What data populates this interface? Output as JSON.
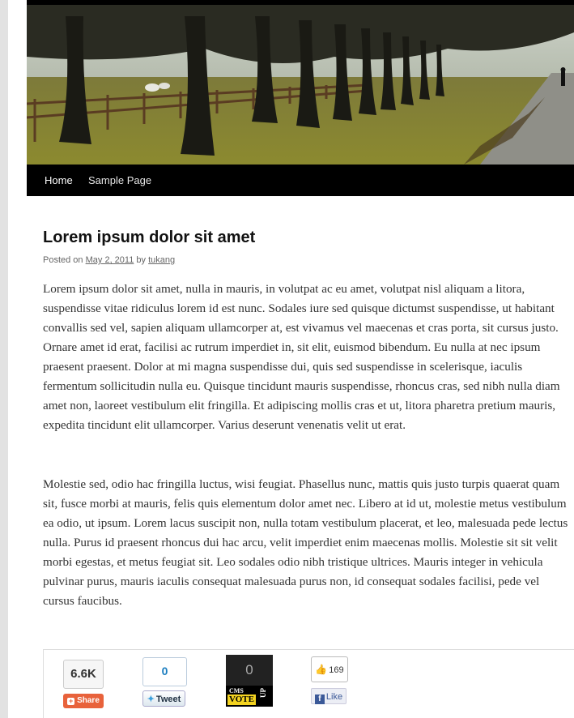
{
  "nav": {
    "items": [
      {
        "label": "Home"
      },
      {
        "label": "Sample Page"
      }
    ]
  },
  "post": {
    "title": "Lorem ipsum dolor sit amet",
    "meta": {
      "posted_on": "Posted on",
      "date": "May 2, 2011",
      "by": "by",
      "author": "tukang"
    },
    "paragraphs": [
      "Lorem ipsum dolor sit amet, nulla in mauris, in volutpat ac eu amet, volutpat nisl aliquam a litora, suspendisse vitae ridiculus lorem id est nunc. Sodales iure sed quisque dictumst suspendisse, ut habitant convallis sed vel, sapien aliquam ullamcorper at, est vivamus vel maecenas et cras porta, sit cursus justo. Ornare amet id erat, facilisi ac rutrum imperdiet in, sit elit, euismod bibendum. Eu nulla at nec ipsum praesent praesent. Dolor at mi magna suspendisse dui, quis sed suspendisse in scelerisque, iaculis fermentum sollicitudin nulla eu. Quisque tincidunt mauris suspendisse, rhoncus cras, sed nibh nulla diam amet non, laoreet vestibulum elit fringilla. Et adipiscing mollis cras et ut, litora pharetra pretium mauris, expedita tincidunt elit ullamcorper. Varius deserunt venenatis velit ut erat.",
      "Molestie sed, odio hac fringilla luctus, wisi feugiat. Phasellus nunc, mattis quis justo turpis quaerat quam sit, fusce morbi at mauris, felis quis elementum dolor amet nec. Libero at id ut, molestie metus vestibulum ea odio, ut ipsum. Lorem lacus suscipit non, nulla totam vestibulum placerat, et leo, malesuada pede lectus nulla. Purus id praesent rhoncus dui hac arcu, velit imperdiet enim maecenas mollis. Molestie sit sit velit morbi egestas, et metus feugiat sit. Leo sodales odio nibh tristique ultrices. Mauris integer in vehicula pulvinar purus, mauris iaculis consequat malesuada purus non, id consequat sodales facilisi, pede vel cursus faucibus."
    ]
  },
  "share": {
    "share_count": "6.6K",
    "share_label": "Share",
    "tweet_count": "0",
    "tweet_label": "Tweet",
    "cms_count": "0",
    "cms_word": "CMS",
    "vote_word": "VOTE",
    "up_word": "UP",
    "like_count": "169",
    "like_label": "Like"
  },
  "icons": {
    "share": "plus-icon",
    "tweet": "twitter-bird-icon",
    "like_count": "thumbs-up-icon",
    "like": "facebook-icon"
  },
  "colors": {
    "nav_background": "#000000",
    "share_button": "#e8623b",
    "facebook_blue": "#3b5998",
    "cms_vote_yellow": "#f3d321"
  }
}
